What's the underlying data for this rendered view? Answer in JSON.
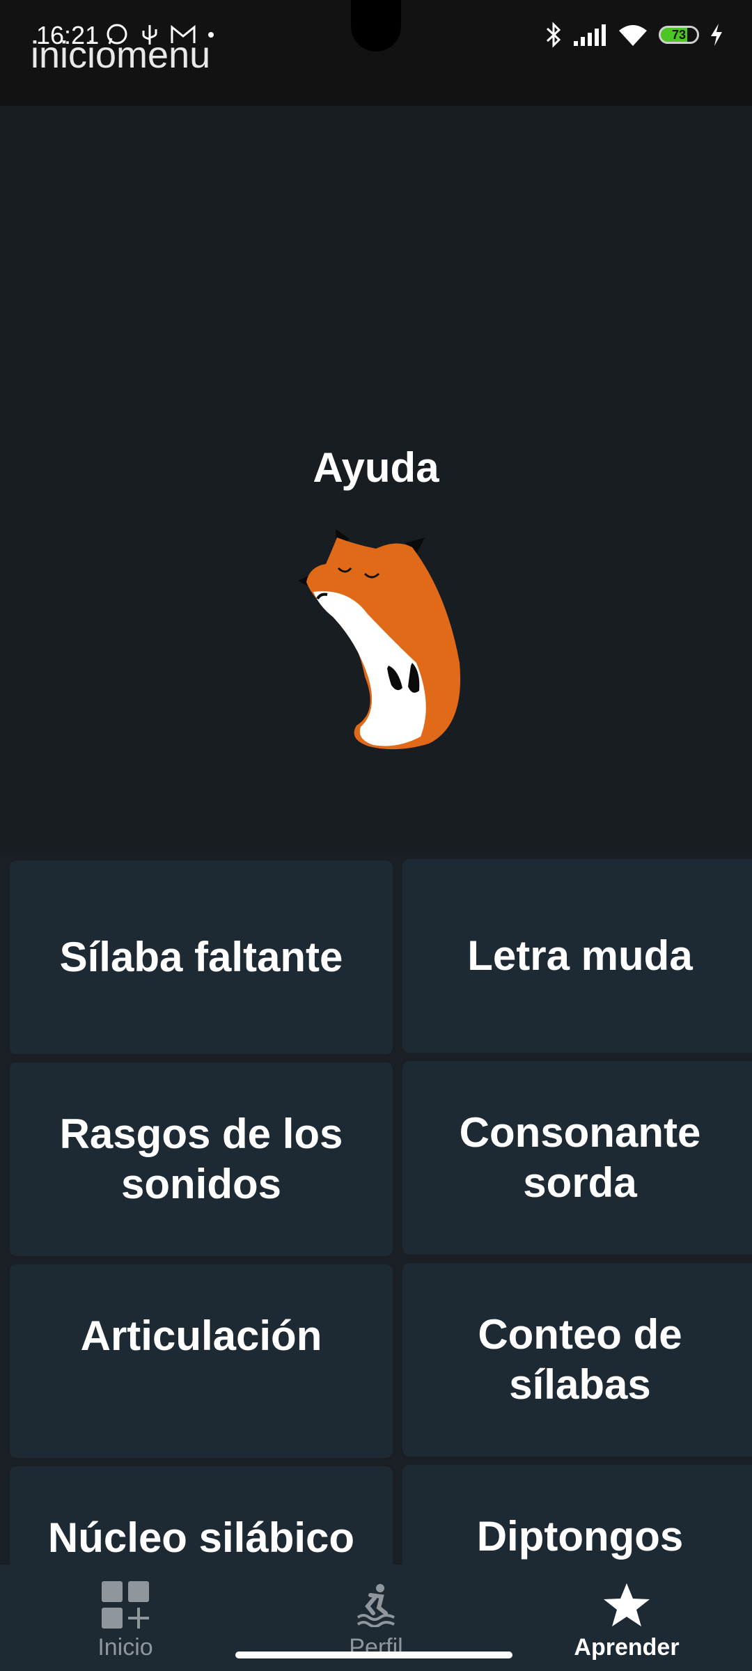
{
  "status_bar": {
    "time": "16:21",
    "battery_level": "73",
    "left_icons": [
      "whatsapp-icon",
      "usb-icon",
      "gmail-icon",
      "dot-icon"
    ],
    "right_icons": [
      "bluetooth-icon",
      "signal-icon",
      "wifi-icon",
      "battery-icon",
      "charging-icon"
    ]
  },
  "app": {
    "title": "iniciomenu"
  },
  "header": {
    "title": "Ayuda",
    "mascot": "fox-mascot"
  },
  "tiles": [
    {
      "label": "Sílaba faltante"
    },
    {
      "label": "Letra muda"
    },
    {
      "label": "Rasgos de los sonidos"
    },
    {
      "label": "Consonante sorda"
    },
    {
      "label": "Articulación"
    },
    {
      "label": "Conteo de sílabas"
    },
    {
      "label": "Núcleo silábico"
    },
    {
      "label": "Diptongos"
    }
  ],
  "bottom_nav": {
    "items": [
      {
        "label": "Inicio",
        "icon": "grid-plus-icon",
        "active": false
      },
      {
        "label": "Perfil",
        "icon": "surfer-icon",
        "active": false
      },
      {
        "label": "Aprender",
        "icon": "star-icon",
        "active": true
      }
    ]
  },
  "colors": {
    "background": "#1a1f25",
    "tile": "#1e2a33",
    "fox_orange": "#e06a17",
    "inactive_nav": "#8f979d",
    "active_nav": "#ffffff",
    "battery_green": "#4cc624"
  }
}
